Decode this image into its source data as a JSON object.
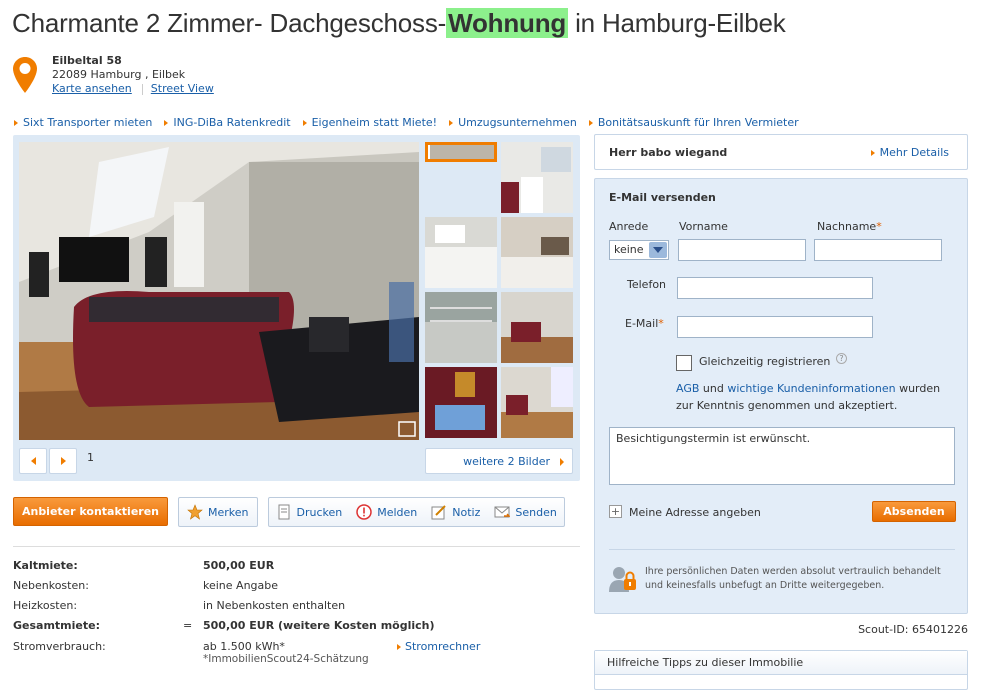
{
  "title": {
    "before": "Charmante 2 Zimmer- Dachgeschoss-",
    "highlight": "Wohnung",
    "after": " in Hamburg-Eilbek"
  },
  "address": {
    "street": "Eilbeltal 58",
    "city": "22089 Hamburg , Eilbek",
    "map_link": "Karte ansehen",
    "street_view_link": "Street View"
  },
  "ad_links": [
    "Sixt Transporter mieten",
    "ING-DiBa Ratenkredit",
    "Eigenheim statt Miete!",
    "Umzugsunternehmen",
    "Bonitätsauskunft für Ihren Vermieter"
  ],
  "gallery": {
    "page_number": "1",
    "more_pictures": "weitere 2 Bilder"
  },
  "actions": {
    "contact": "Anbieter kontaktieren",
    "remember": "Merken",
    "print": "Drucken",
    "report": "Melden",
    "note": "Notiz",
    "send": "Senden"
  },
  "costs": [
    {
      "label": "Kaltmiete:",
      "eq": "",
      "value": "500,00 EUR",
      "bold": true
    },
    {
      "label": "Nebenkosten:",
      "eq": "",
      "value": "keine Angabe",
      "bold": false
    },
    {
      "label": "Heizkosten:",
      "eq": "",
      "value": "in Nebenkosten enthalten",
      "bold": false
    },
    {
      "label": "Gesamtmiete:",
      "eq": "=",
      "value": "500,00 EUR (weitere Kosten möglich)",
      "bold": true
    },
    {
      "label": "Stromverbrauch:",
      "eq": "",
      "value": "ab 1.500 kWh*",
      "bold": false
    }
  ],
  "strom": {
    "note": "*ImmobilienScout24-Schätzung",
    "link": "Stromrechner"
  },
  "contact_person": {
    "name": "Herr babo wiegand",
    "details_link": "Mehr Details"
  },
  "email_form": {
    "title": "E-Mail versenden",
    "salutation_label": "Anrede",
    "salutation_value": "keine",
    "firstname_label": "Vorname",
    "lastname_label": "Nachname",
    "phone_label": "Telefon",
    "email_label": "E-Mail",
    "required_mark": "*",
    "register_label": "Gleichzeitig registrieren",
    "help_mark": "?",
    "terms_link1": "AGB",
    "terms_and": " und ",
    "terms_link2": "wichtige Kundeninformationen",
    "terms_rest1": " wurden",
    "terms_rest2": "zur Kenntnis genommen und akzeptiert.",
    "message": "Besichtigungstermin ist erwünscht.",
    "add_address": "Meine Adresse angeben",
    "plus": "+",
    "submit": "Absenden",
    "privacy_line1": "Ihre persönlichen Daten werden absolut vertraulich behandelt",
    "privacy_line2": "und keinesfalls unbefugt an Dritte weitergegeben."
  },
  "scout_id": "Scout-ID: 65401226",
  "tips_header": "Hilfreiche Tipps zu dieser Immobilie"
}
